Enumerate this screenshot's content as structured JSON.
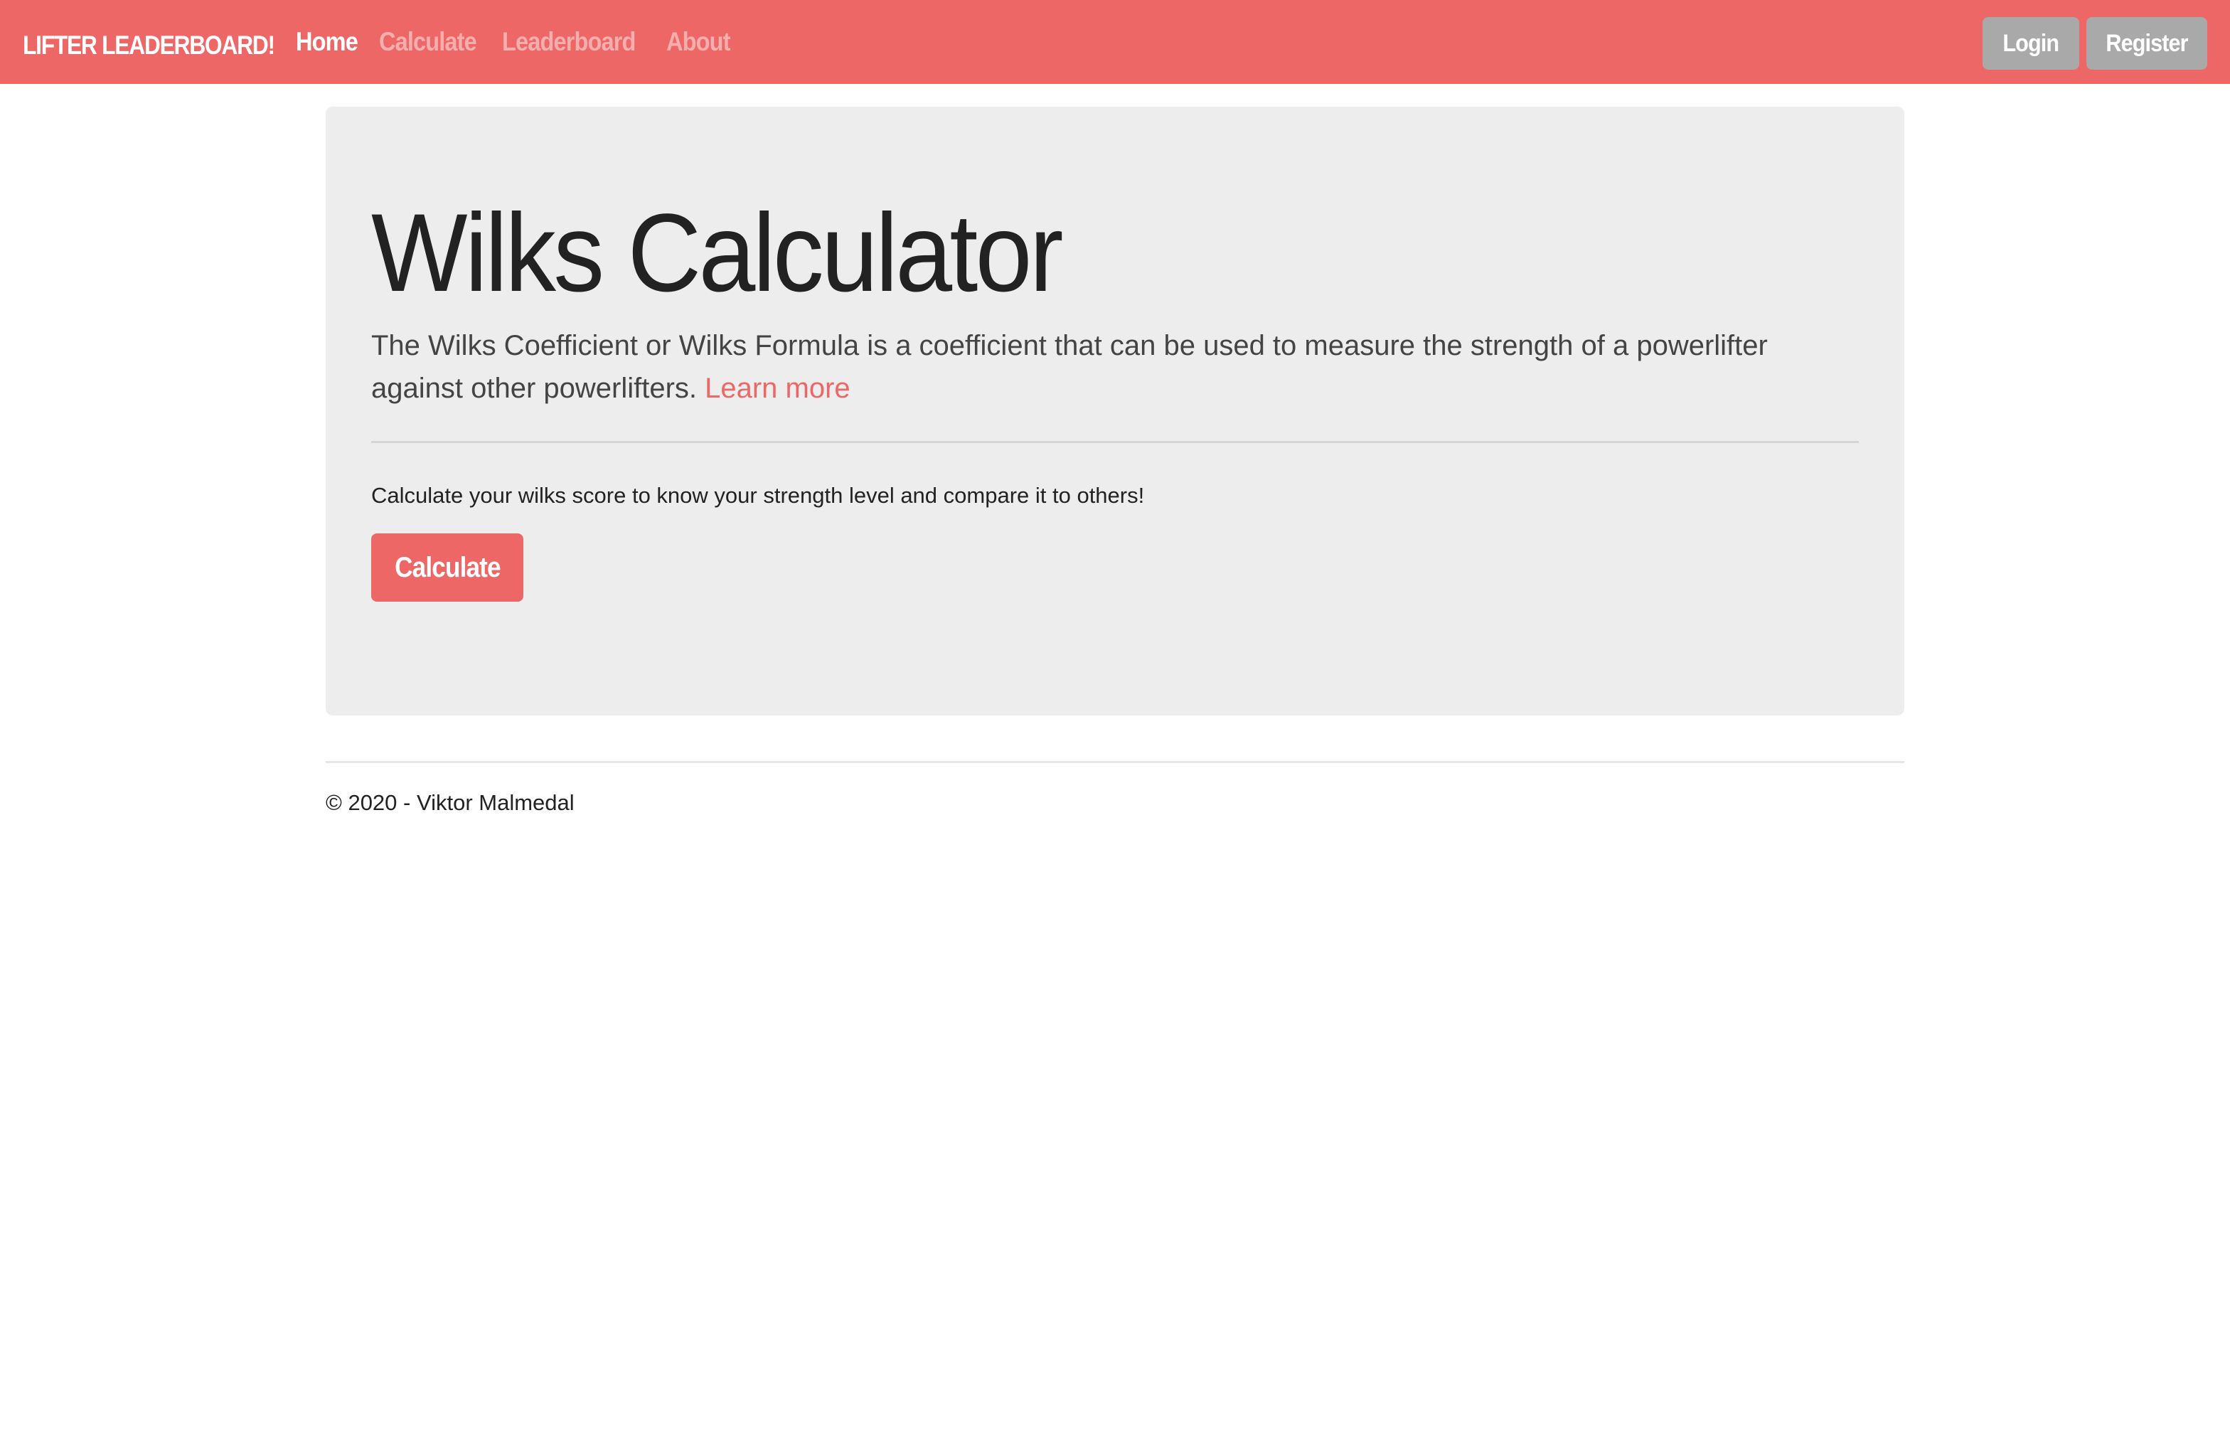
{
  "navbar": {
    "brand": "LIFTER LEADERBOARD!",
    "links": [
      {
        "label": "Home",
        "active": true
      },
      {
        "label": "Calculate",
        "active": false
      },
      {
        "label": "Leaderboard",
        "active": false
      },
      {
        "label": "About",
        "active": false
      }
    ],
    "login_label": "Login",
    "register_label": "Register"
  },
  "jumbotron": {
    "title": "Wilks Calculator",
    "lead": "The Wilks Coefficient or Wilks Formula is a coefficient that can be used to measure the strength of a powerlifter against other powerlifters.",
    "learn_more": "Learn more",
    "subtext": "Calculate your wilks score to know your strength level and compare it to others!",
    "calculate_button": "Calculate"
  },
  "footer": {
    "text": "© 2020 - Viktor Malmedal"
  },
  "colors": {
    "accent": "#ec6766",
    "nav_button": "#a9a9a9",
    "jumbotron_bg": "#ededed"
  }
}
